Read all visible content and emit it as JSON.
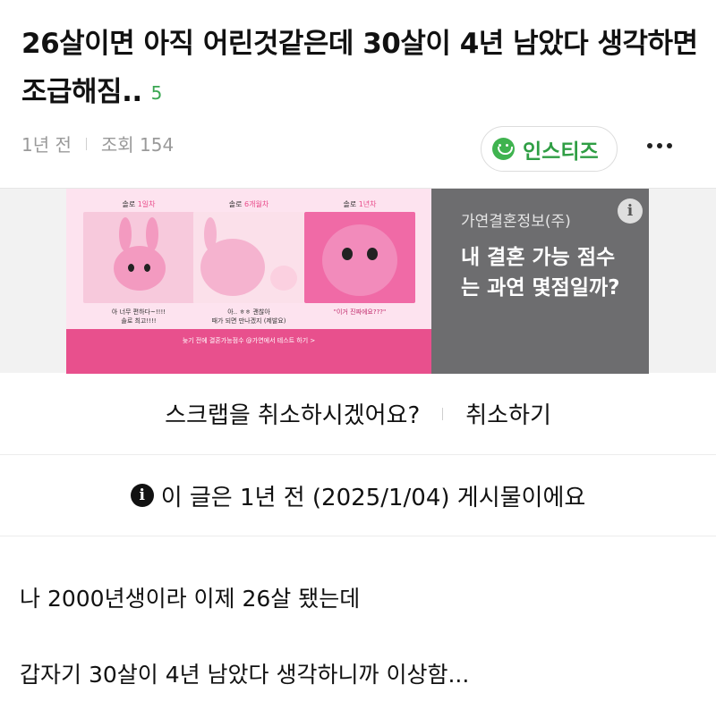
{
  "post": {
    "title": "26살이면 아직 어린것같은데 30살이 4년 남았다 생각하면 조급해짐..",
    "comment_count": "5",
    "time_ago": "1년 전",
    "views": "조회 154",
    "channel_name": "인스티즈",
    "channel_icon": "smile-icon",
    "more_icon": "more-icon"
  },
  "ad": {
    "panels": [
      {
        "title_prefix": "솔로 ",
        "title_highlight": "1일차",
        "caption": "아 너무 편하다~!!!!\n솔로 최고!!!!"
      },
      {
        "title_prefix": "솔로 ",
        "title_highlight": "6개월차",
        "caption": "아.. ㅎㅎ 괜찮아\n때가 되면 만나겠지 (제발요)"
      },
      {
        "title_prefix": "솔로 ",
        "title_highlight": "1년차",
        "caption": "\"이거 진짜에요???\""
      }
    ],
    "footer": "늦기 전에 결혼가능점수 @가연에서 테스트 하기 >",
    "advertiser": "가연결혼정보(주)",
    "headline": "내 결혼 가능 점수는 과연 몇점일까?",
    "info_icon": "i"
  },
  "scrap": {
    "question": "스크랩을 취소하시겠어요?",
    "cancel_label": "취소하기"
  },
  "notice": {
    "icon": "i",
    "text": "이 글은 1년 전 (2025/1/04) 게시물이에요"
  },
  "body": {
    "line1": "나 2000년생이라 이제 26살 됐는데",
    "line2": "갑자기 30살이 4년 남았다 생각하니까 이상함..."
  },
  "colors": {
    "accent_green": "#3fb34f",
    "ad_pink": "#e8508d",
    "ad_gray": "#6d6d6f"
  }
}
